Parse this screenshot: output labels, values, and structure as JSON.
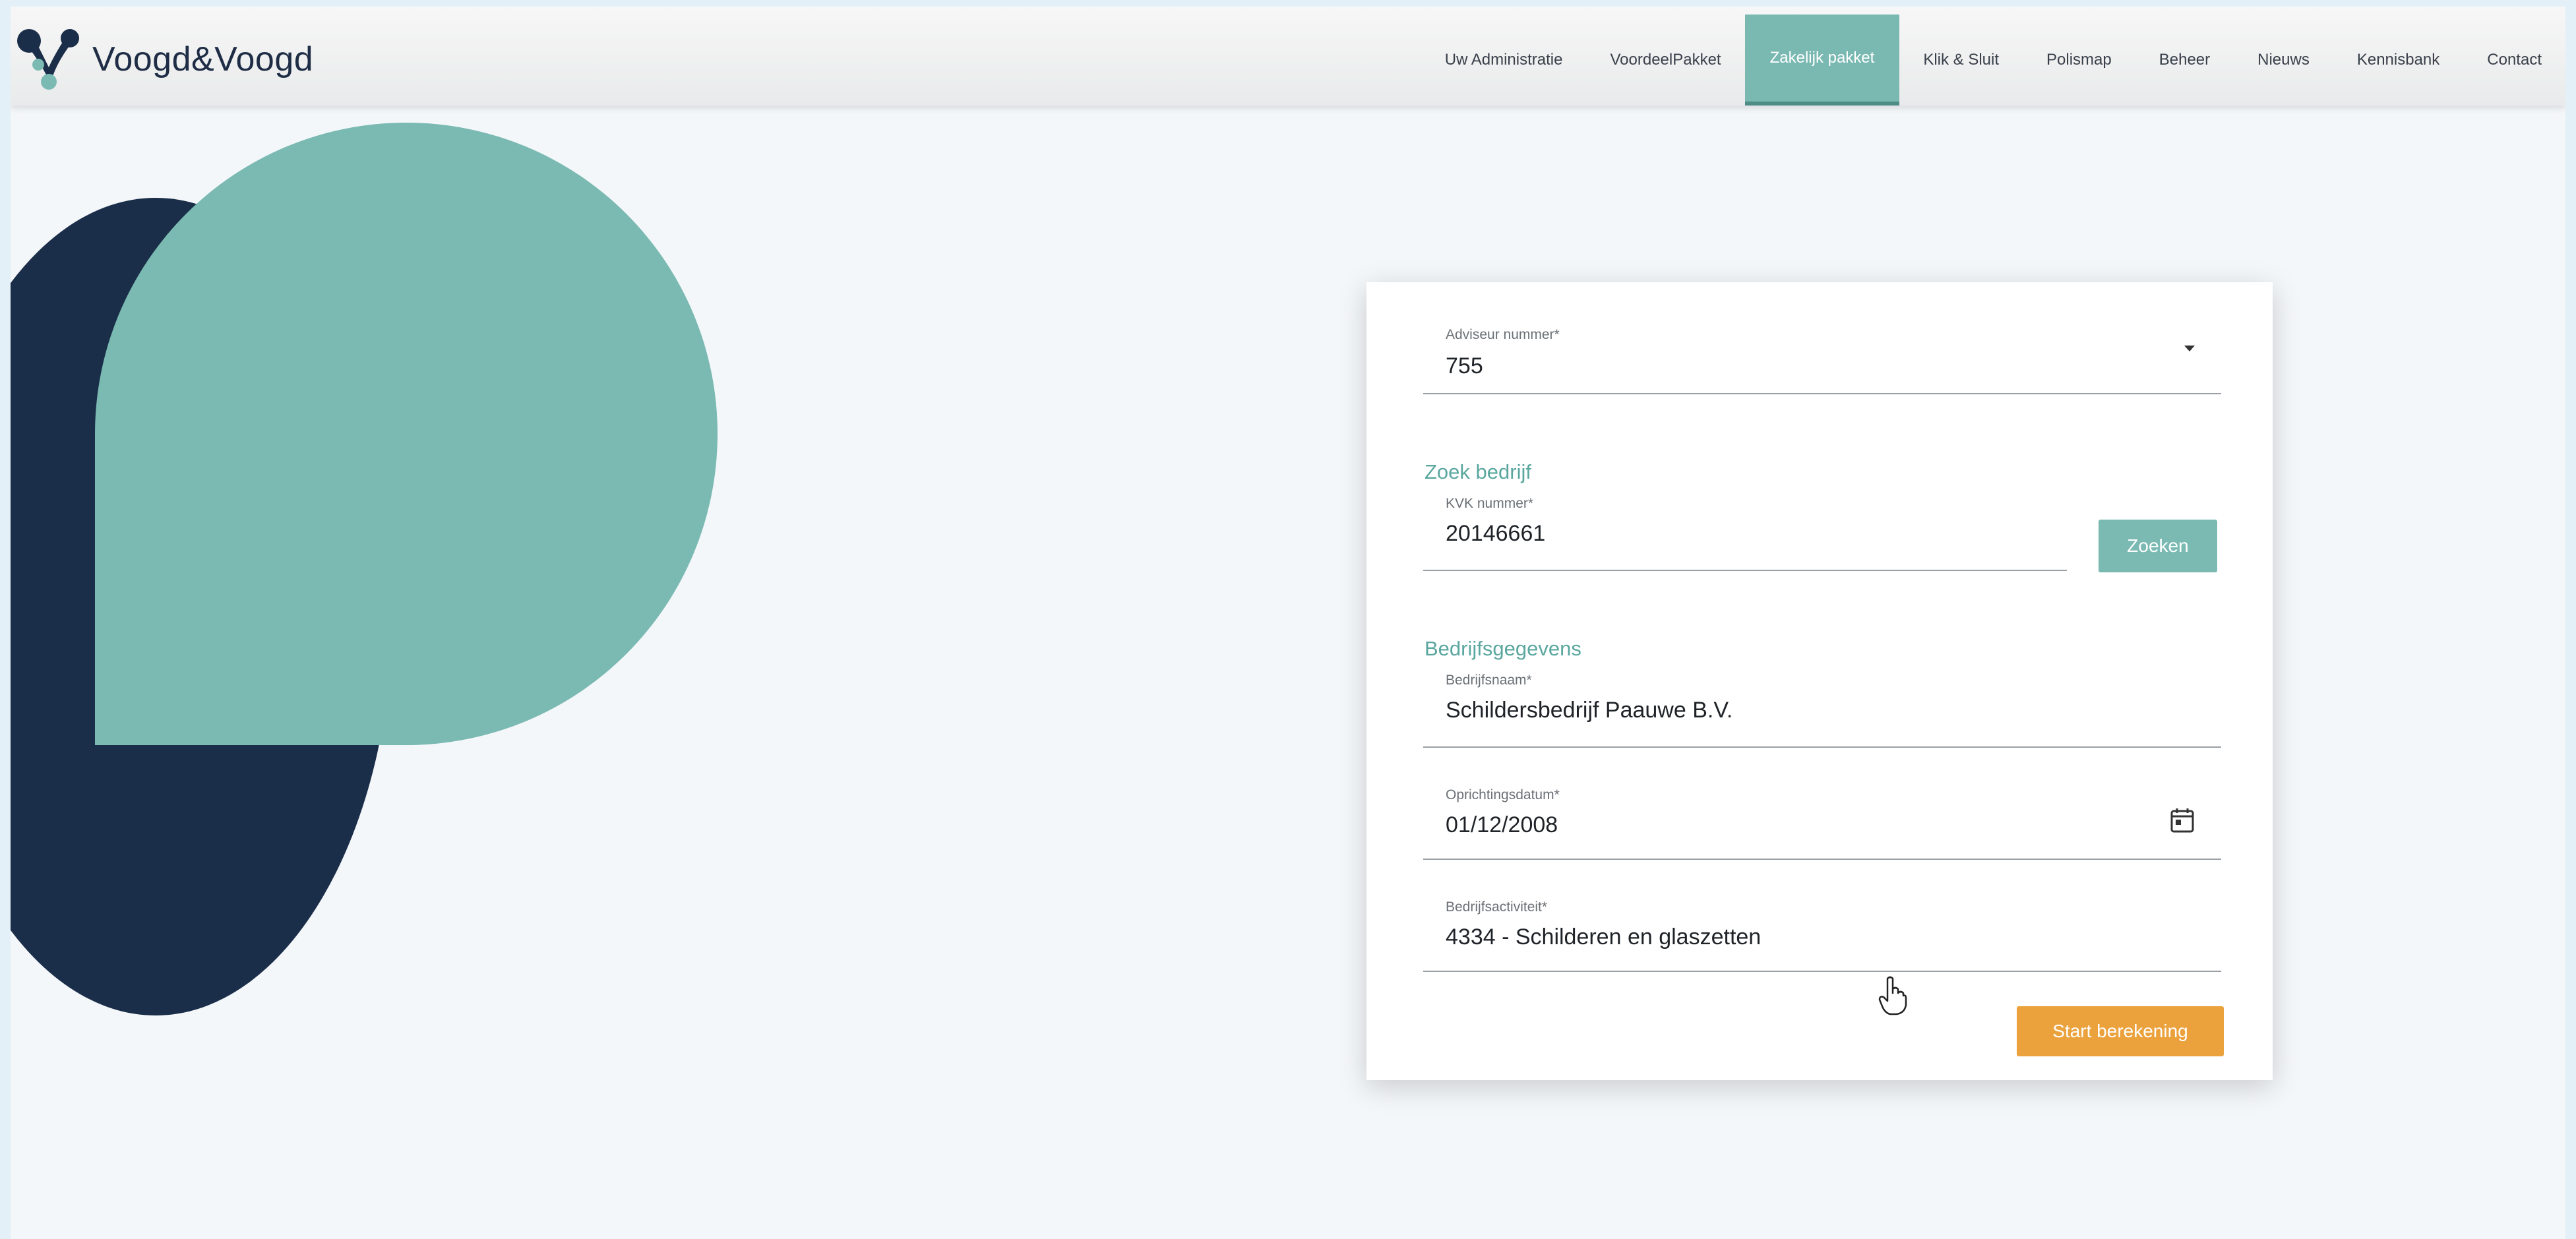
{
  "brand": {
    "name": "Voogd&Voogd"
  },
  "nav": {
    "items": [
      {
        "label": "Uw Administratie",
        "active": false
      },
      {
        "label": "VoordeelPakket",
        "active": false
      },
      {
        "label": "Zakelijk pakket",
        "active": true
      },
      {
        "label": "Klik & Sluit",
        "active": false
      },
      {
        "label": "Polismap",
        "active": false
      },
      {
        "label": "Beheer",
        "active": false
      },
      {
        "label": "Nieuws",
        "active": false
      },
      {
        "label": "Kennisbank",
        "active": false
      },
      {
        "label": "Contact",
        "active": false
      }
    ]
  },
  "form": {
    "advisor": {
      "label": "Adviseur nummer*",
      "value": "755"
    },
    "search_section": {
      "title": "Zoek bedrijf"
    },
    "kvk": {
      "label": "KVK nummer*",
      "value": "20146661"
    },
    "search_button": "Zoeken",
    "company_section": {
      "title": "Bedrijfsgegevens"
    },
    "company_name": {
      "label": "Bedrijfsnaam*",
      "value": "Schildersbedrijf Paauwe B.V."
    },
    "founding_date": {
      "label": "Oprichtingsdatum*",
      "value": "01/12/2008"
    },
    "activity": {
      "label": "Bedrijfsactiviteit*",
      "value": "4334 - Schilderen en glaszetten"
    },
    "start_button": "Start berekening"
  },
  "colors": {
    "teal": "#7bbab3",
    "navy": "#1b2e49",
    "orange": "#eba23c"
  },
  "icons": {
    "logo": "voogd-logo-icon",
    "dropdown": "caret-down-icon",
    "calendar": "calendar-icon",
    "cursor": "hand-pointer-icon"
  }
}
